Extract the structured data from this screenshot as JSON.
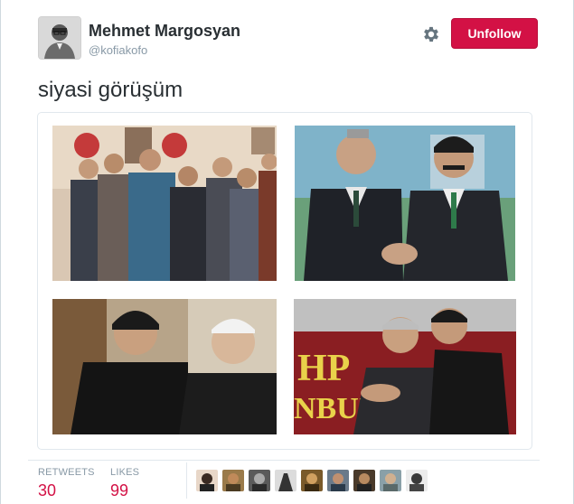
{
  "user": {
    "display_name": "Mehmet Margosyan",
    "handle": "@kofiakofo",
    "avatar_icon": "person-avatar-icon"
  },
  "actions": {
    "settings_icon": "gear-icon",
    "unfollow_label": "Unfollow",
    "unfollow_color": "#d31145"
  },
  "tweet": {
    "text": "siyasi görüşüm"
  },
  "media": {
    "photos": [
      {
        "name": "photo-group-portrait"
      },
      {
        "name": "photo-handshake"
      },
      {
        "name": "photo-two-men-indoor"
      },
      {
        "name": "photo-embrace"
      }
    ]
  },
  "stats": {
    "retweets_label": "RETWEETS",
    "retweets_value": "30",
    "likes_label": "LIKES",
    "likes_value": "99"
  },
  "likers_count_shown": 9
}
